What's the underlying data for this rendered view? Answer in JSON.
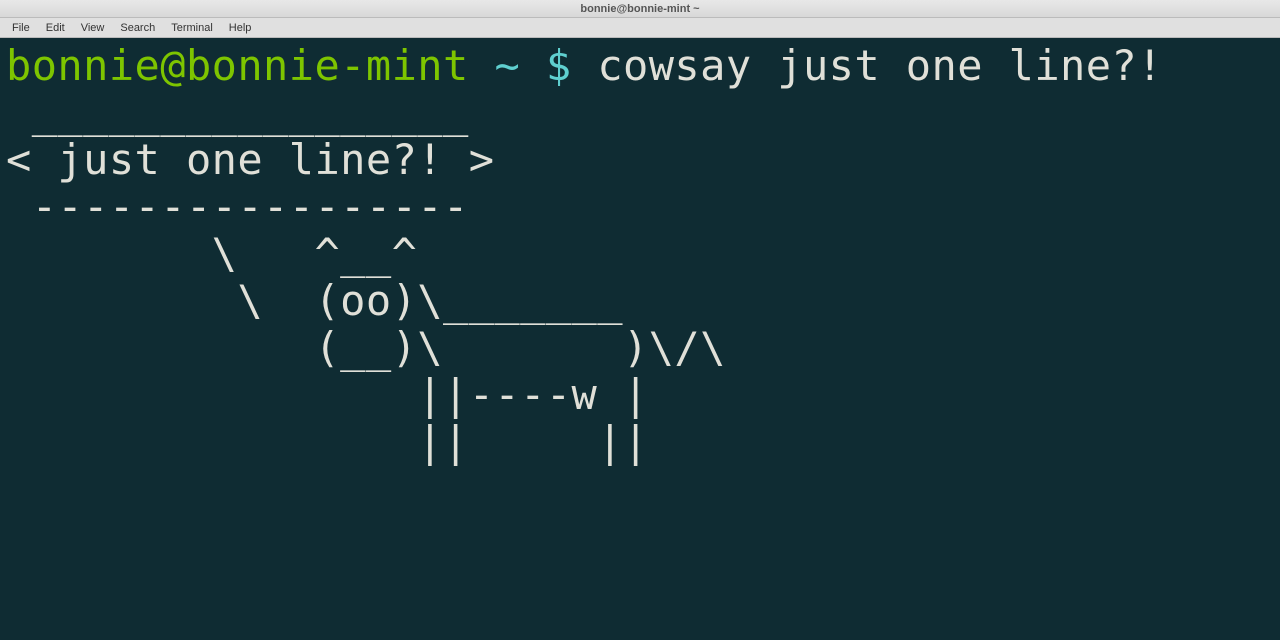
{
  "window": {
    "title": "bonnie@bonnie-mint ~"
  },
  "menubar": {
    "items": [
      "File",
      "Edit",
      "View",
      "Search",
      "Terminal",
      "Help"
    ]
  },
  "terminal": {
    "prompt": {
      "user_host": "bonnie@bonnie-mint",
      "cwd": "~",
      "symbol": "$"
    },
    "command": "cowsay just one line?!",
    "output_lines": [
      " _________________",
      "< just one line?! >",
      " -----------------",
      "        \\   ^__^",
      "         \\  (oo)\\_______",
      "            (__)\\       )\\/\\",
      "                ||----w |",
      "                ||     ||"
    ]
  }
}
